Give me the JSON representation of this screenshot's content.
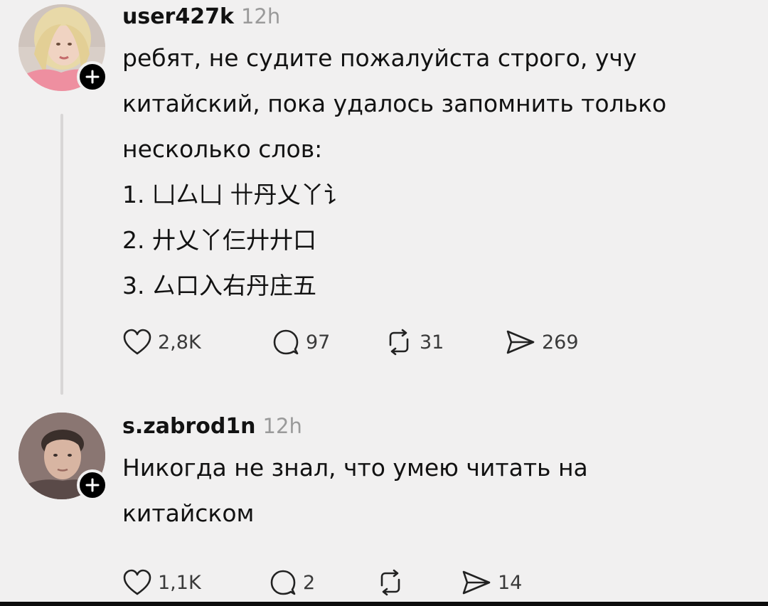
{
  "posts": [
    {
      "username": "user427k",
      "time": "12h",
      "lines": [
        "ребят, не судите пожалуйста строго, учу",
        "китайский, пока удалось запомнить только",
        "несколько слов:",
        "1. 凵厶凵 卄丹乂丫讠",
        " 2. 廾乂丫仨廾廾口",
        "3. 厶口入右丹庄五"
      ],
      "likes": "2,8K",
      "replies": "97",
      "reposts": "31",
      "shares": "269"
    },
    {
      "username": "s.zabrod1n",
      "time": "12h",
      "lines": [
        "Никогда не знал, что умею читать на",
        "китайском"
      ],
      "likes": "1,1K",
      "replies": "2",
      "reposts": "",
      "shares": "14"
    }
  ],
  "icons": {
    "like": "heart-icon",
    "reply": "speech-bubble-icon",
    "repost": "repost-arrows-icon",
    "share": "send-icon",
    "follow": "plus-icon"
  },
  "colors": {
    "background": "#f1f0f0",
    "text": "#121212",
    "muted": "#9a9a9a",
    "badge": "#000000"
  }
}
